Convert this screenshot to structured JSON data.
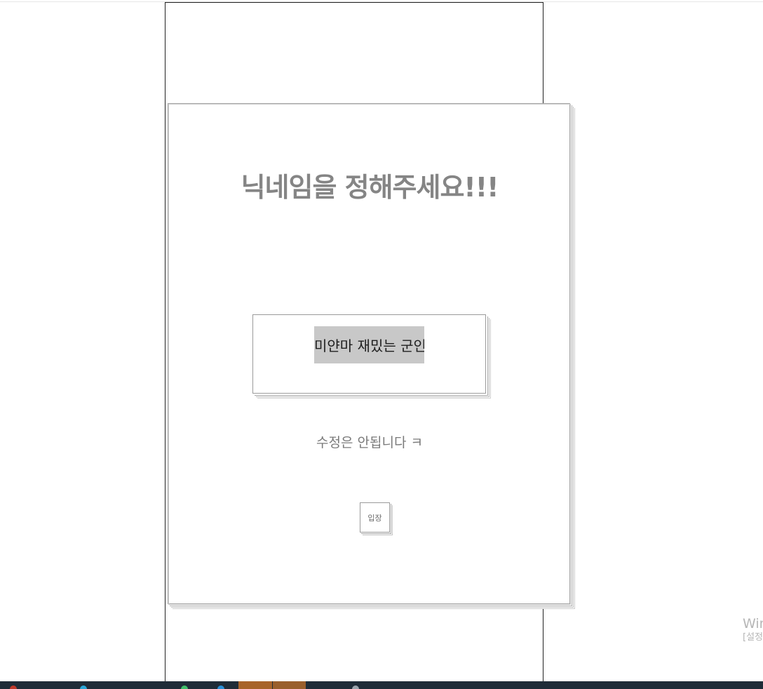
{
  "screen": {
    "title": "닉네임을 정해주세요!!!",
    "nickname_value": "미얀마 재밌는 군인",
    "notice": "수정은 안됩니다  ㅋ",
    "enter_label": "입장"
  },
  "watermark": {
    "title": "Win",
    "subtitle": "[설정"
  },
  "colors": {
    "title": "#858585",
    "input_highlight": "#c8c8c8",
    "taskbar": "#1f2c38"
  },
  "taskbar": {
    "icons": [
      "browser-icon",
      "edge-icon",
      "store-icon",
      "chat-icon",
      "app-icon",
      "folder-icon",
      "search-icon"
    ]
  }
}
